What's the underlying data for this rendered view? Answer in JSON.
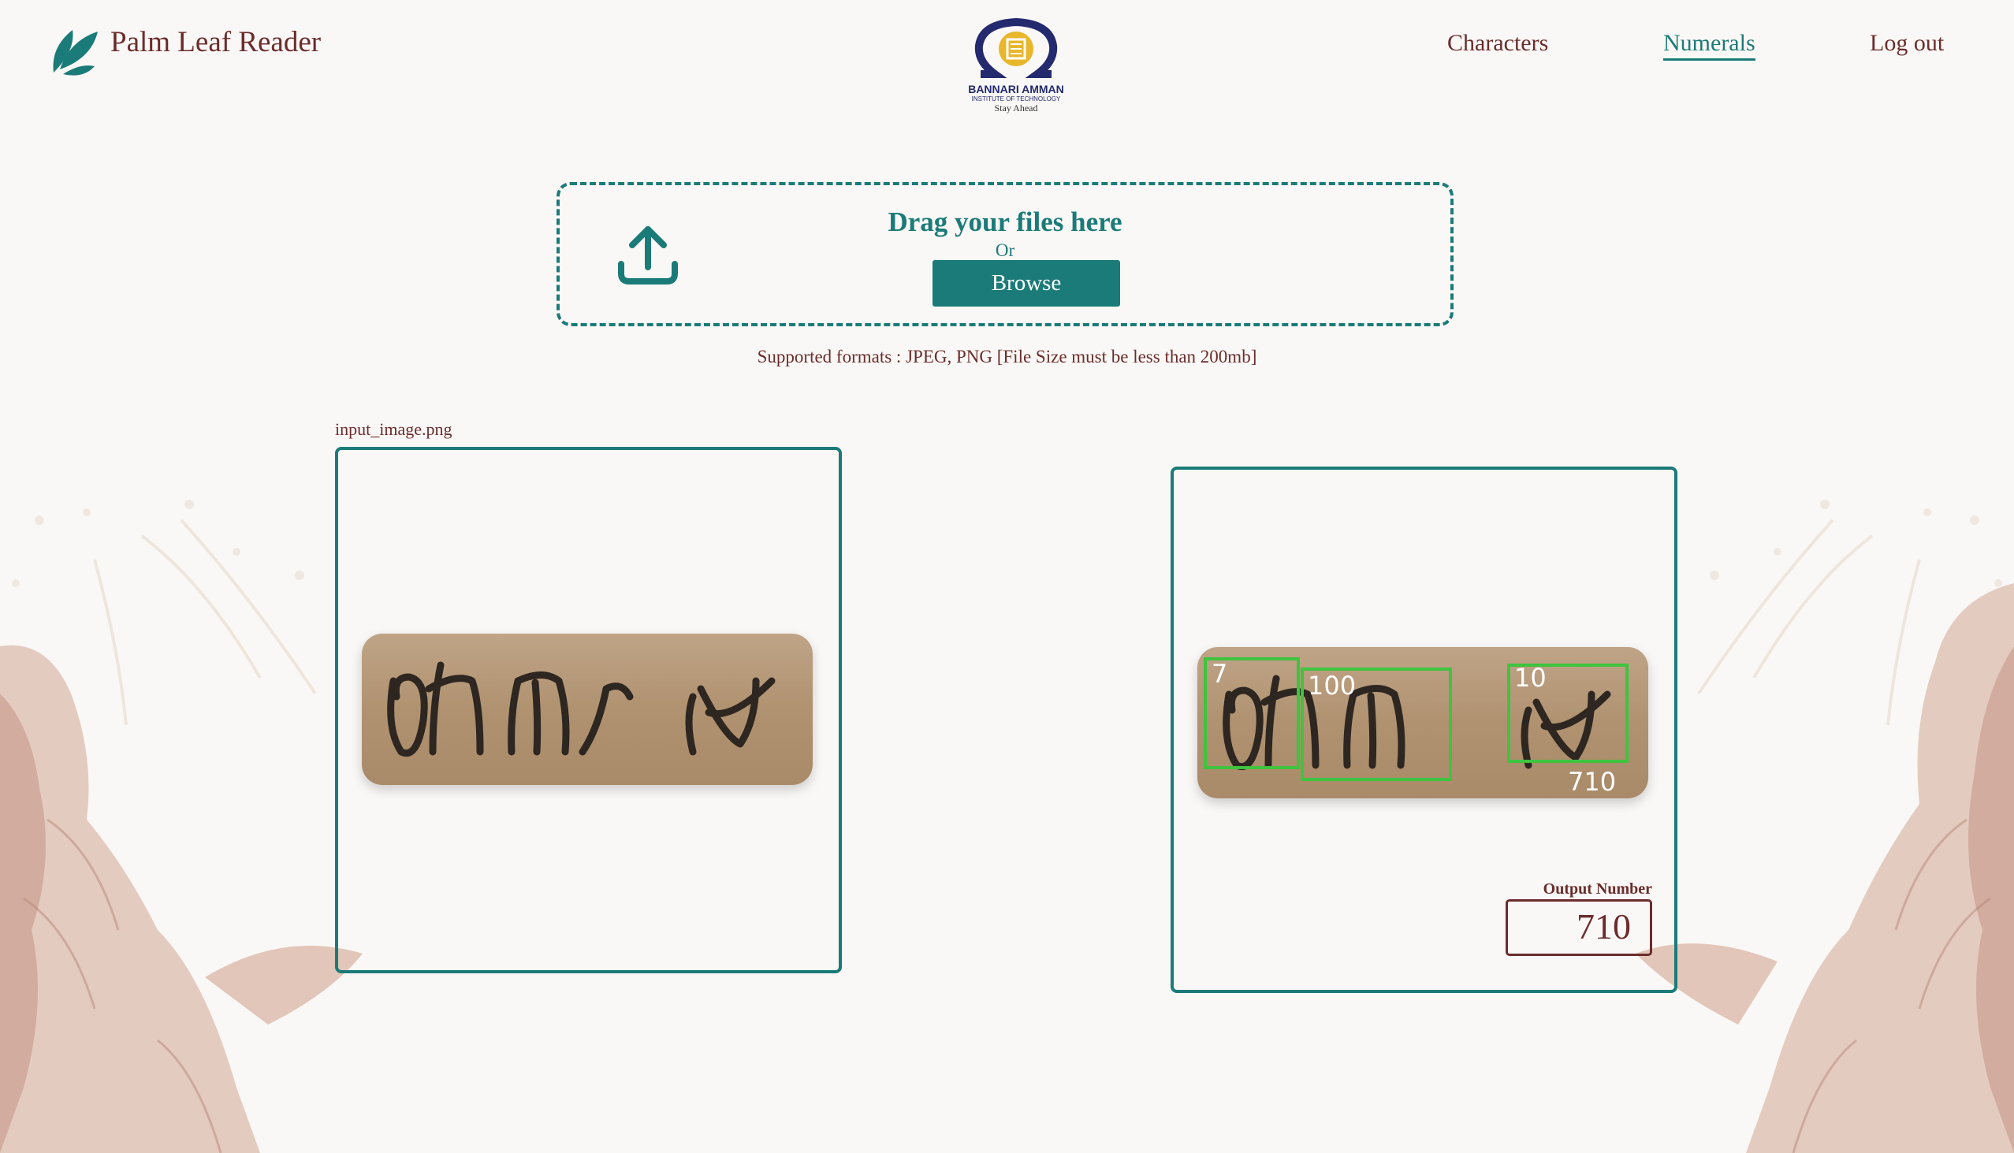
{
  "app": {
    "title": "Palm Leaf Reader"
  },
  "institution": {
    "name": "BANNARI AMMAN",
    "subtitle": "INSTITUTE OF TECHNOLOGY",
    "tagline": "Stay Ahead"
  },
  "nav": {
    "items": [
      {
        "label": "Characters",
        "active": false
      },
      {
        "label": "Numerals",
        "active": true
      },
      {
        "label": "Log out",
        "active": false
      }
    ]
  },
  "upload": {
    "drag_text": "Drag your files here",
    "or_text": "Or",
    "browse_label": "Browse",
    "formats_text": "Supported formats : JPEG, PNG [File Size must be less than 200mb]"
  },
  "input": {
    "file_name": "input_image.png"
  },
  "detections": [
    {
      "label": "7"
    },
    {
      "label": "100"
    },
    {
      "label": "10"
    }
  ],
  "result": {
    "overlay_value": "710",
    "output_label": "Output Number",
    "output_value": "710"
  },
  "colors": {
    "accent": "#1b7b78",
    "text": "#6b2c2c",
    "detection_box": "#3ec43e"
  }
}
